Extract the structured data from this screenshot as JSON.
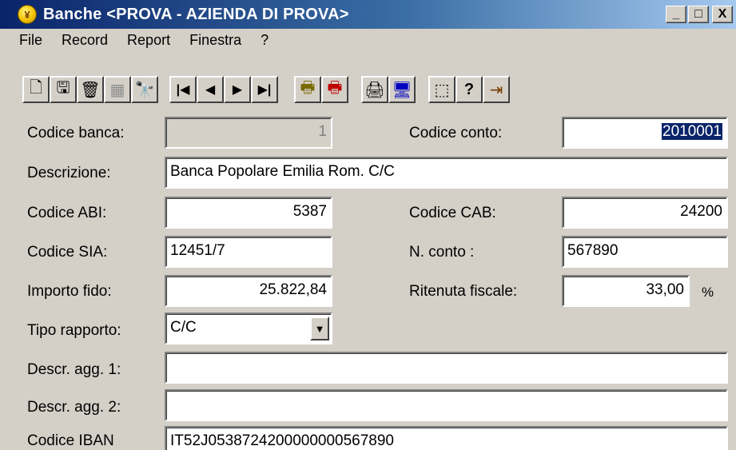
{
  "window": {
    "title": "Banche <PROVA - AZIENDA DI PROVA>",
    "app_icon": "yen-coin-icon",
    "controls": {
      "minimize": "_",
      "maximize": "□",
      "close": "X"
    }
  },
  "menu": [
    "File",
    "Record",
    "Report",
    "Finestra",
    "?"
  ],
  "toolbar": [
    {
      "name": "new-icon",
      "glyph": "🗋"
    },
    {
      "name": "save-icon",
      "glyph": "🖫"
    },
    {
      "name": "delete-icon",
      "glyph": "🗑"
    },
    {
      "name": "disabled-tool-icon",
      "glyph": "▦"
    },
    {
      "name": "find-icon",
      "glyph": "🔭"
    },
    {
      "name": "first-record-icon",
      "glyph": "|◀"
    },
    {
      "name": "previous-record-icon",
      "glyph": "◀"
    },
    {
      "name": "next-record-icon",
      "glyph": "▶"
    },
    {
      "name": "last-record-icon",
      "glyph": "▶|"
    },
    {
      "name": "print-preview-icon",
      "glyph": "🖶"
    },
    {
      "name": "print-report-icon",
      "glyph": "🖶"
    },
    {
      "name": "printer-icon",
      "glyph": "🖨"
    },
    {
      "name": "monitor-icon",
      "glyph": "🖥"
    },
    {
      "name": "select-area-icon",
      "glyph": "⬚"
    },
    {
      "name": "help-icon",
      "glyph": "?"
    },
    {
      "name": "exit-icon",
      "glyph": "⇥"
    }
  ],
  "form": {
    "codice_banca": {
      "label": "Codice banca:",
      "value": "1"
    },
    "codice_conto": {
      "label": "Codice conto:",
      "value": "2010001"
    },
    "descrizione": {
      "label": "Descrizione:",
      "value": "Banca Popolare Emilia Rom. C/C"
    },
    "codice_abi": {
      "label": "Codice ABI:",
      "value": "5387"
    },
    "codice_cab": {
      "label": "Codice CAB:",
      "value": "24200"
    },
    "codice_sia": {
      "label": "Codice SIA:",
      "value": "12451/7"
    },
    "n_conto": {
      "label": "N. conto :",
      "value": "567890"
    },
    "importo_fido": {
      "label": "Importo fido:",
      "value": "25.822,84"
    },
    "ritenuta_fiscale": {
      "label": "Ritenuta fiscale:",
      "value": "33,00",
      "unit": "%"
    },
    "tipo_rapporto": {
      "label": "Tipo rapporto:",
      "value": "C/C"
    },
    "descr_agg_1": {
      "label": "Descr. agg. 1:",
      "value": ""
    },
    "descr_agg_2": {
      "label": "Descr. agg. 2:",
      "value": ""
    },
    "codice_iban": {
      "label": "Codice IBAN",
      "value": "IT52J0538724200000000567890"
    }
  },
  "colors": {
    "titlebar_start": "#0a246a",
    "titlebar_end": "#a6caf0",
    "window_bg": "#d4d0c8",
    "selection": "#0a246a"
  }
}
